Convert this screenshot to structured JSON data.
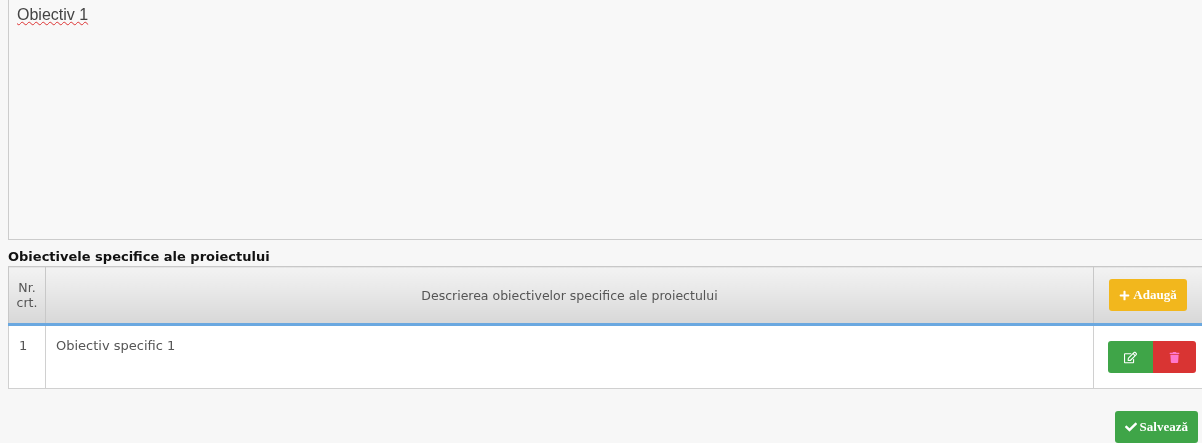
{
  "objective_field": {
    "value": "Obiectiv 1"
  },
  "section_title": "Obiectivele specifice ale proiectului",
  "table": {
    "columns": [
      "Nr. crt.",
      "Descrierea obiectivelor specifice ale proiectului"
    ],
    "add_button": "Adaugă",
    "rows": [
      {
        "number": "1",
        "description": "Obiectiv specific 1"
      }
    ]
  },
  "save_button": "Salvează"
}
